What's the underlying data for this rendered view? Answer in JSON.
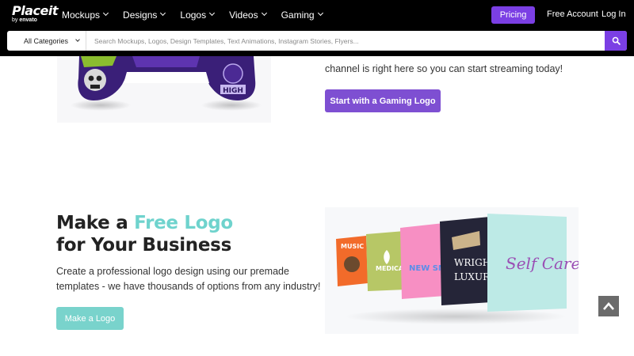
{
  "header": {
    "logo": {
      "main": "Placeit",
      "by": "by",
      "brand": "envato"
    },
    "nav": [
      {
        "label": "Mockups",
        "icon": "chevron-down-icon"
      },
      {
        "label": "Designs",
        "icon": "chevron-down-icon"
      },
      {
        "label": "Logos",
        "icon": "chevron-down-icon"
      },
      {
        "label": "Videos",
        "icon": "chevron-down-icon"
      },
      {
        "label": "Gaming",
        "icon": "chevron-down-icon"
      }
    ],
    "pricing_label": "Pricing",
    "free_account_label": "Free Account",
    "login_label": "Log In"
  },
  "search": {
    "category_label": "All Categories",
    "placeholder": "Search Mockups, Logos, Design Templates, Text Animations, Instagram Stories, Flyers...",
    "value": "",
    "button_icon": "search-icon"
  },
  "gaming": {
    "partial_text": "channel is right here so you can start streaming today!",
    "cta_label": "Start with a Gaming Logo",
    "gamepad_text": "HIGH"
  },
  "logo_section": {
    "headline_pre": "Make a ",
    "headline_accent": "Free Logo",
    "headline_line2": "for Your Business",
    "description_line1": "Create a professional logo design using our premade",
    "description_line2": "templates - we have thousands of options from any industry!",
    "cta_label": "Make a Logo",
    "cards": [
      "MUSIC",
      "MEDICA",
      "NEW SM",
      "WRIGH LUXUR",
      "Self Care"
    ]
  },
  "scroll_top": {
    "icon": "arrow-up-icon"
  },
  "colors": {
    "brand_purple": "#7b3fe4",
    "button_purple": "#7e4fd2",
    "accent_teal": "#6fd3cd",
    "header_bg": "#000000"
  }
}
